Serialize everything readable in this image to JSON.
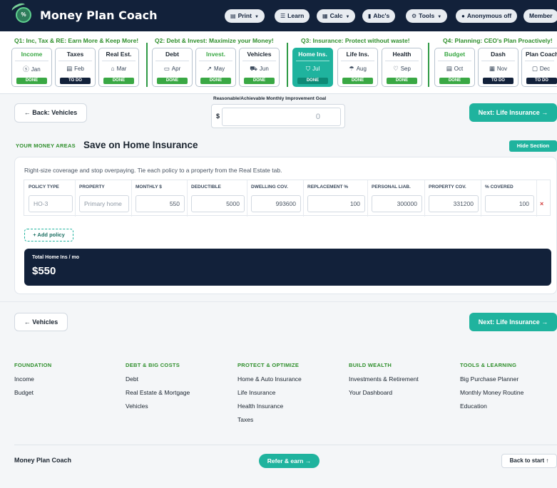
{
  "app": {
    "brand": "Money Plan Coach",
    "logo_text": "%"
  },
  "topbar": {
    "print": "Print",
    "learn": "Learn",
    "calc": "Calc",
    "abcs": "Abc's",
    "tools": "Tools",
    "anonymous": "Anonymous off",
    "member": "Member"
  },
  "quarters": [
    {
      "title": "Q1: Inc, Tax & RE: Earn More & Keep More!",
      "cards": [
        {
          "name": "Income",
          "month": "Jan",
          "status": "DONE",
          "icon": "dollar-circle-icon"
        },
        {
          "name": "Taxes",
          "month": "Feb",
          "status": "TO DO",
          "icon": "document-icon"
        },
        {
          "name": "Real Est.",
          "month": "Mar",
          "status": "DONE",
          "icon": "house-icon"
        }
      ]
    },
    {
      "title": "Q2: Debt & Invest: Maximize your Money!",
      "cards": [
        {
          "name": "Debt",
          "month": "Apr",
          "status": "DONE",
          "icon": "credit-card-icon"
        },
        {
          "name": "Invest.",
          "month": "May",
          "status": "DONE",
          "icon": "trend-chart-icon"
        },
        {
          "name": "Vehicles",
          "month": "Jun",
          "status": "DONE",
          "icon": "car-icon"
        }
      ]
    },
    {
      "title": "Q3: Insurance: Protect without waste!",
      "cards": [
        {
          "name": "Home Ins.",
          "month": "Jul",
          "status": "DONE",
          "icon": "shield-icon"
        },
        {
          "name": "Life Ins.",
          "month": "Aug",
          "status": "DONE",
          "icon": "umbrella-icon"
        },
        {
          "name": "Health",
          "month": "Sep",
          "status": "DONE",
          "icon": "heart-icon"
        }
      ]
    },
    {
      "title": "Q4: Planning: CEO's Plan Proactively!",
      "cards": [
        {
          "name": "Budget",
          "month": "Oct",
          "status": "DONE",
          "icon": "clipboard-icon"
        },
        {
          "name": "Dash",
          "month": "Nov",
          "status": "TO DO",
          "icon": "grid-icon"
        },
        {
          "name": "Plan Coach",
          "month": "Dec",
          "status": "TO DO",
          "icon": "chat-icon"
        }
      ]
    }
  ],
  "nav": {
    "back_top": "← Back: Vehicles",
    "next_top": "Next: Life Insurance →",
    "back_bottom": "← Vehicles",
    "next_bottom": "Next: Life Insurance →"
  },
  "goal": {
    "label": "Reasonable/Achievable Monthly Improvement Goal",
    "currency": "$",
    "value": "0"
  },
  "section": {
    "eyebrow": "YOUR MONEY AREAS",
    "title": "Save on Home Insurance",
    "hide_label": "Hide Section",
    "description": "Right-size coverage and stop overpaying. Tie each policy to a property from the Real Estate tab."
  },
  "table": {
    "headers": [
      "POLICY TYPE",
      "PROPERTY",
      "MONTHLY $",
      "DEDUCTIBLE",
      "DWELLING COV.",
      "REPLACEMENT %",
      "PERSONAL LIAB.",
      "PROPERTY COV.",
      "% COVERED"
    ],
    "row": {
      "policy_type": "HO-3",
      "property": "Primary home",
      "monthly": "550",
      "deductible": "5000",
      "dwelling": "993600",
      "replacement": "100",
      "liability": "300000",
      "property_cov": "331200",
      "covered": "100",
      "remove": "×"
    },
    "add_label": "+ Add policy"
  },
  "total": {
    "label": "Total Home Ins / mo",
    "value": "$550"
  },
  "footer": {
    "columns": [
      {
        "heading": "FOUNDATION",
        "links": [
          "Income",
          "Budget"
        ]
      },
      {
        "heading": "DEBT & BIG COSTS",
        "links": [
          "Debt",
          "Real Estate & Mortgage",
          "Vehicles"
        ]
      },
      {
        "heading": "PROTECT & OPTIMIZE",
        "links": [
          "Home & Auto Insurance",
          "Life Insurance",
          "Health Insurance",
          "Taxes"
        ]
      },
      {
        "heading": "BUILD WEALTH",
        "links": [
          "Investments & Retirement",
          "Your Dashboard"
        ]
      },
      {
        "heading": "TOOLS & LEARNING",
        "links": [
          "Big Purchase Planner",
          "Monthly Money Routine",
          "Education"
        ]
      }
    ],
    "brand": "Money Plan Coach",
    "refer": "Refer & earn →",
    "back_to_start": "Back to start ↑"
  },
  "colors": {
    "navy": "#12213a",
    "teal": "#1fb39e",
    "green": "#3aa844",
    "danger": "#d23b3b"
  }
}
